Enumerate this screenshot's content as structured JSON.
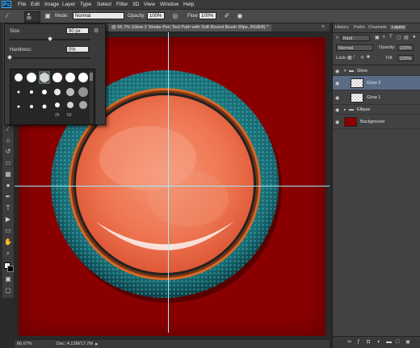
{
  "app": {
    "logo": "Ps"
  },
  "menu": [
    "File",
    "Edit",
    "Image",
    "Layer",
    "Type",
    "Select",
    "Filter",
    "3D",
    "View",
    "Window",
    "Help"
  ],
  "options_bar": {
    "brush_size": "90",
    "mode_label": "Mode:",
    "mode_value": "Normal",
    "opacity_label": "Opacity:",
    "opacity_value": "100%",
    "flow_label": "Flow:",
    "flow_value": "100%"
  },
  "document_tab": "@ 66.7% (Glow 2  Stroke Pen Tool Path with Soft Round Brush 90px, RGB/8) *",
  "brush_picker": {
    "size_label": "Size:",
    "size_value": "90 px",
    "hardness_label": "Hardness:",
    "hardness_value": "0%",
    "size_fraction": 0.5,
    "hardness_fraction": 0.0,
    "preset_numbers": [
      "25",
      "50"
    ]
  },
  "status": {
    "zoom": "66.67%",
    "doc": "Doc: 4.12M/17.7M"
  },
  "panel": {
    "tabs": [
      "History",
      "Paths",
      "Channels",
      "Layers"
    ],
    "active_tab": "Layers",
    "kind_label": "Kind",
    "blend_mode": "Normal",
    "opacity_label": "Opacity:",
    "opacity_value": "100%",
    "lock_label": "Lock:",
    "fill_label": "Fill:",
    "fill_value": "100%",
    "layers": [
      {
        "name": "Glow",
        "type": "group"
      },
      {
        "name": "Glow 2",
        "type": "layer",
        "selected": true
      },
      {
        "name": "Glow 1",
        "type": "layer"
      },
      {
        "name": "Ellipse",
        "type": "group"
      },
      {
        "name": "Background",
        "type": "layer",
        "color": "#8b0000"
      }
    ]
  },
  "colors": {
    "canvas": "#8a0000",
    "ring": "#1f7d84",
    "orb": "#f07a55",
    "selection": "#5a6b86"
  }
}
